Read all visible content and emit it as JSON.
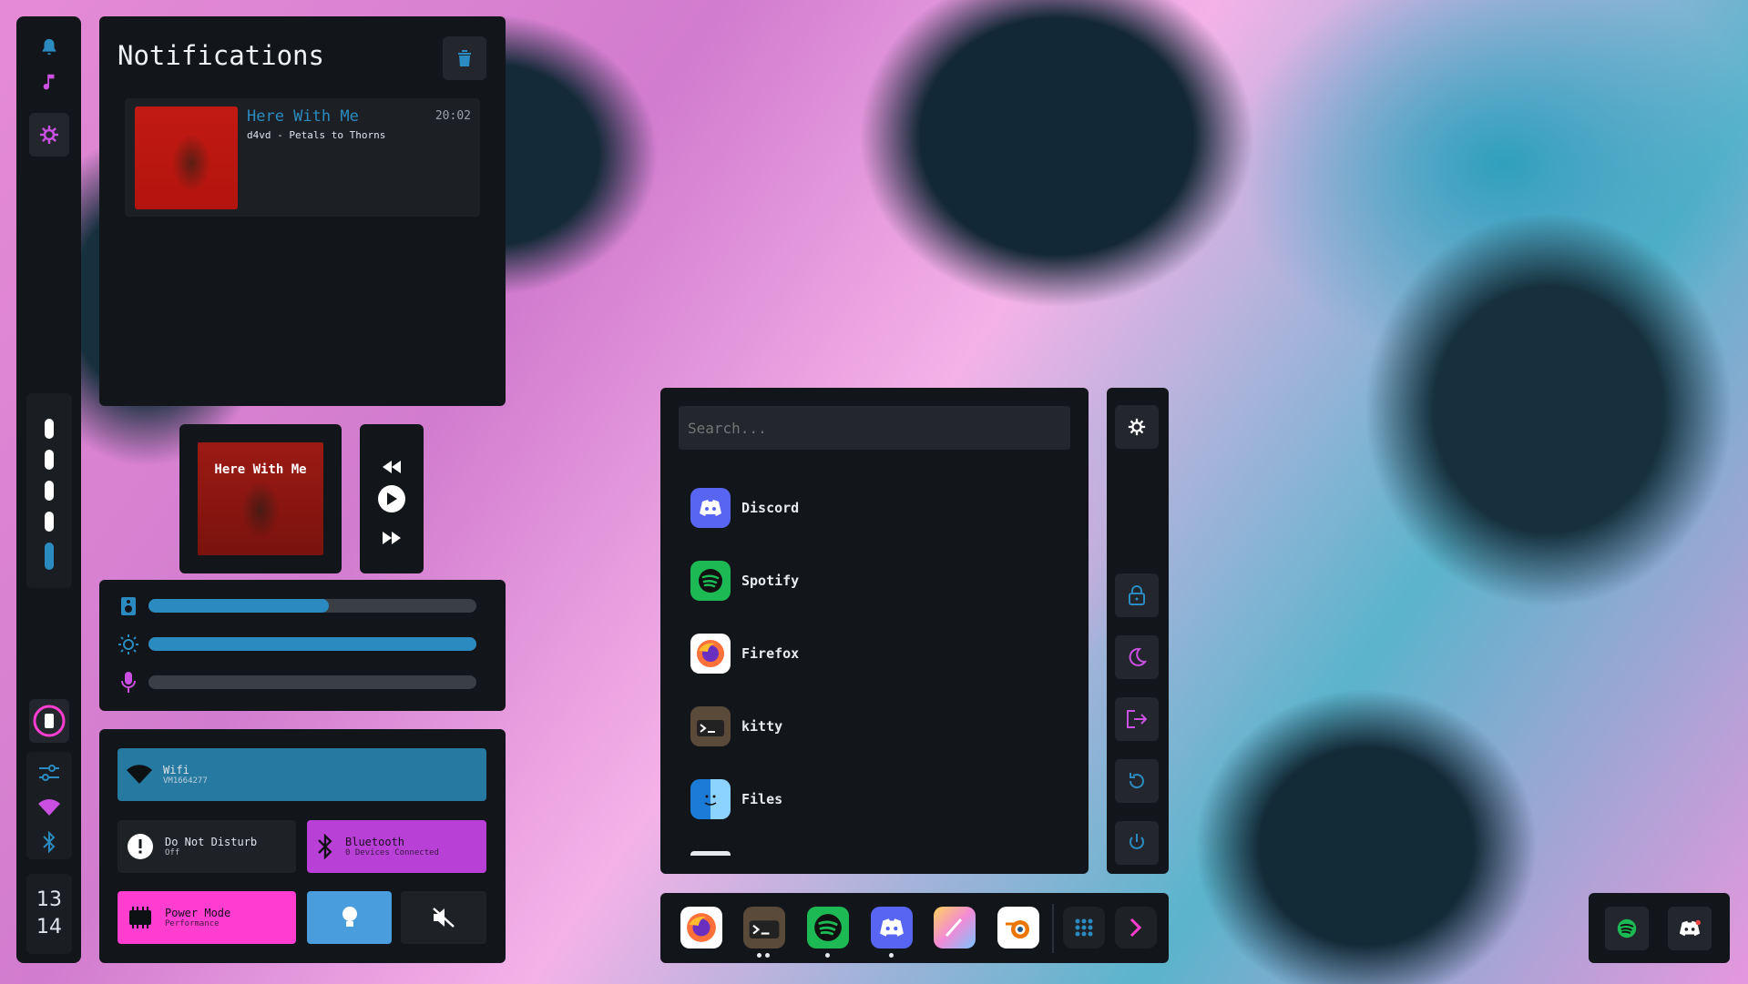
{
  "notifications": {
    "title": "Notifications",
    "items": [
      {
        "title": "Here With Me",
        "subtitle": "d4vd - Petals to Thorns",
        "time": "20:02"
      }
    ]
  },
  "media": {
    "title": "Here With Me"
  },
  "sliders": {
    "volume": 0.55,
    "brightness": 1.0,
    "microphone": 0.0
  },
  "quick": {
    "wifi": {
      "label": "Wifi",
      "sub": "VM1664277"
    },
    "dnd": {
      "label": "Do Not Disturb",
      "sub": "Off"
    },
    "bluetooth": {
      "label": "Bluetooth",
      "sub": "0 Devices Connected"
    },
    "power": {
      "label": "Power Mode",
      "sub": "Performance"
    }
  },
  "launcher": {
    "placeholder": "Search...",
    "apps": [
      {
        "name": "Discord",
        "icon": "discord-icon"
      },
      {
        "name": "Spotify",
        "icon": "spotify-icon"
      },
      {
        "name": "Firefox",
        "icon": "firefox-icon"
      },
      {
        "name": "kitty",
        "icon": "kitty-icon"
      },
      {
        "name": "Files",
        "icon": "files-icon"
      }
    ]
  },
  "clock": {
    "hour": "13",
    "minute": "14"
  },
  "colors": {
    "accent": "#2b8bc0",
    "magenta": "#ff3ed0",
    "purple": "#b940d6",
    "panel": "#121519"
  }
}
